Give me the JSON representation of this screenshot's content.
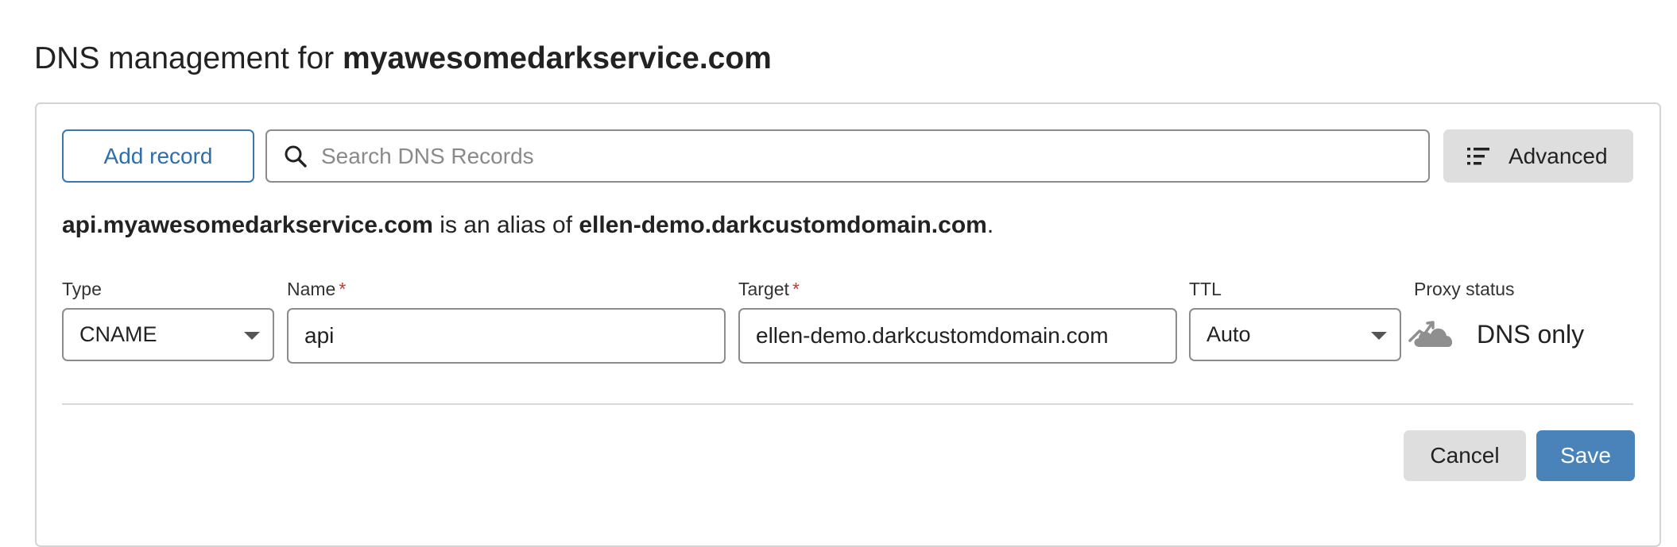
{
  "page": {
    "title_prefix": "DNS management for ",
    "domain": "myawesomedarkservice.com"
  },
  "toolbar": {
    "add_record_label": "Add record",
    "search_placeholder": "Search DNS Records",
    "search_icon": "search-icon",
    "advanced_label": "Advanced",
    "advanced_icon": "list-icon"
  },
  "alias_notice": {
    "source": "api.myawesomedarkservice.com",
    "middle_text": " is an alias of ",
    "target": "ellen-demo.darkcustomdomain.com",
    "end": "."
  },
  "record_form": {
    "type": {
      "label": "Type",
      "value": "CNAME"
    },
    "name": {
      "label": "Name",
      "required_mark": "*",
      "value": "api"
    },
    "target": {
      "label": "Target",
      "required_mark": "*",
      "value": "ellen-demo.darkcustomdomain.com"
    },
    "ttl": {
      "label": "TTL",
      "value": "Auto"
    },
    "proxy_status": {
      "label": "Proxy status",
      "value": "DNS only",
      "icon": "cloud-icon"
    }
  },
  "actions": {
    "cancel_label": "Cancel",
    "save_label": "Save"
  },
  "colors": {
    "accent": "#2f6ea9",
    "save_button": "#4a83ba",
    "required": "#c0392b",
    "secondary_button": "#dedede"
  }
}
